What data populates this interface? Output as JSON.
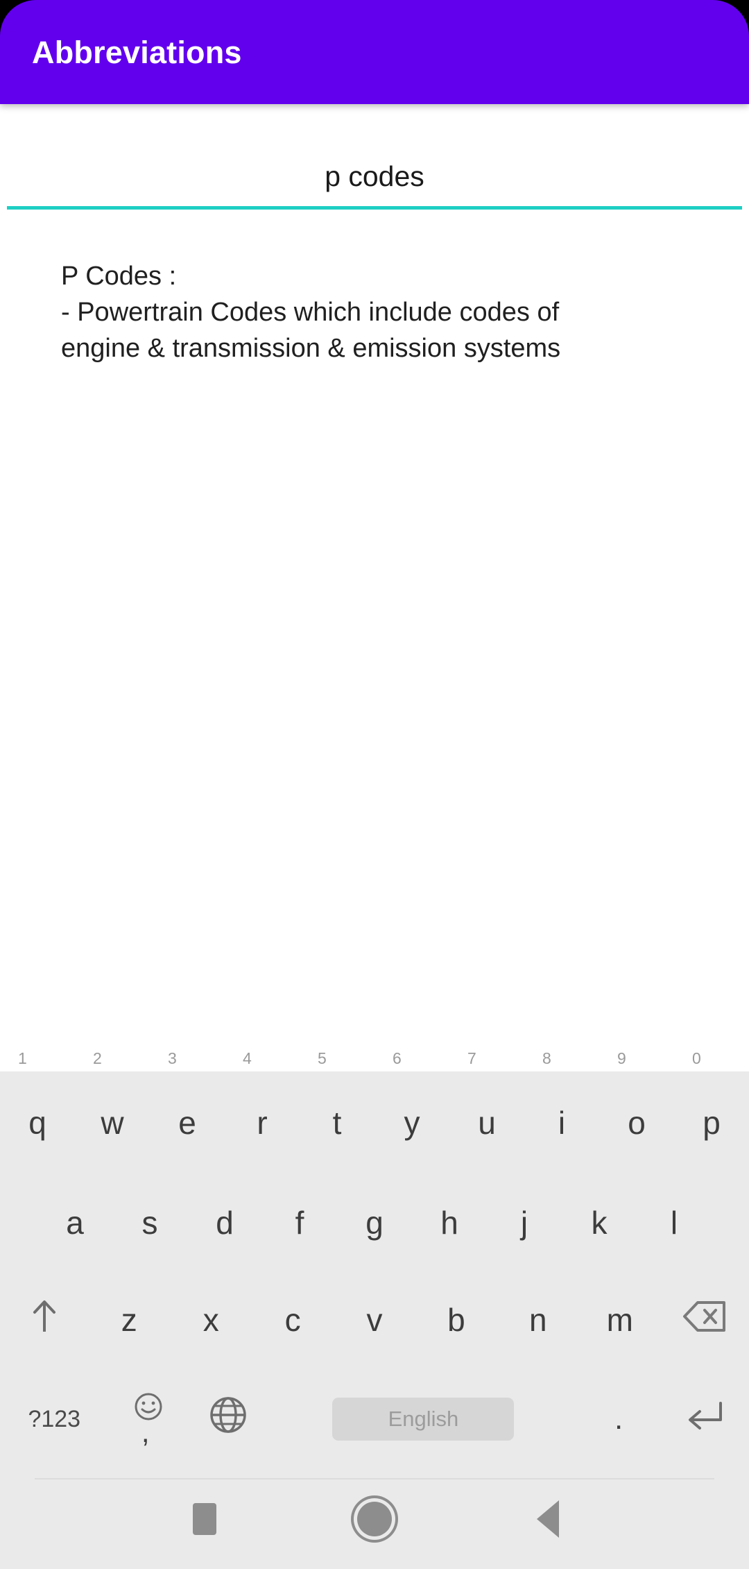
{
  "app": {
    "title": "Abbreviations",
    "accent_color": "#6200EE",
    "underline_color": "#1ECFC4"
  },
  "search": {
    "value": "p codes",
    "placeholder": "p codes"
  },
  "result": {
    "heading": "P Codes :",
    "line1": "- Powertrain Codes which include codes of",
    "line2": "engine & transmission & emission systems"
  },
  "keyboard": {
    "row1": [
      {
        "label": "q",
        "sup": "1"
      },
      {
        "label": "w",
        "sup": "2"
      },
      {
        "label": "e",
        "sup": "3"
      },
      {
        "label": "r",
        "sup": "4"
      },
      {
        "label": "t",
        "sup": "5"
      },
      {
        "label": "y",
        "sup": "6"
      },
      {
        "label": "u",
        "sup": "7"
      },
      {
        "label": "i",
        "sup": "8"
      },
      {
        "label": "o",
        "sup": "9"
      },
      {
        "label": "p",
        "sup": "0"
      }
    ],
    "row2": [
      {
        "label": "a"
      },
      {
        "label": "s"
      },
      {
        "label": "d"
      },
      {
        "label": "f"
      },
      {
        "label": "g"
      },
      {
        "label": "h"
      },
      {
        "label": "j"
      },
      {
        "label": "k"
      },
      {
        "label": "l"
      }
    ],
    "row3": {
      "shift": "shift-icon",
      "letters": [
        {
          "label": "z"
        },
        {
          "label": "x"
        },
        {
          "label": "c"
        },
        {
          "label": "v"
        },
        {
          "label": "b"
        },
        {
          "label": "n"
        },
        {
          "label": "m"
        }
      ],
      "backspace": "backspace-icon"
    },
    "row4": {
      "symbols": "?123",
      "emoji": "smiley-icon",
      "comma": ",",
      "globe": "globe-icon",
      "space_label": "English",
      "period": ".",
      "enter": "enter-icon"
    }
  },
  "navbar": {
    "recents": "square-icon",
    "home": "circle-icon",
    "back": "triangle-back-icon"
  }
}
